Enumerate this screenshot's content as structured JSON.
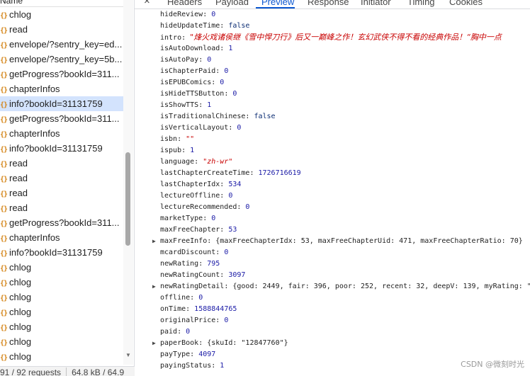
{
  "request_list": {
    "header": "Name",
    "items": [
      {
        "label": "chlog",
        "selected": false
      },
      {
        "label": "read",
        "selected": false
      },
      {
        "label": "envelope/?sentry_key=ed...",
        "selected": false
      },
      {
        "label": "envelope/?sentry_key=5b...",
        "selected": false
      },
      {
        "label": "getProgress?bookId=311...",
        "selected": false
      },
      {
        "label": "chapterInfos",
        "selected": false
      },
      {
        "label": "info?bookId=31131759",
        "selected": true
      },
      {
        "label": "getProgress?bookId=311...",
        "selected": false
      },
      {
        "label": "chapterInfos",
        "selected": false
      },
      {
        "label": "info?bookId=31131759",
        "selected": false
      },
      {
        "label": "read",
        "selected": false
      },
      {
        "label": "read",
        "selected": false
      },
      {
        "label": "read",
        "selected": false
      },
      {
        "label": "read",
        "selected": false
      },
      {
        "label": "getProgress?bookId=311...",
        "selected": false
      },
      {
        "label": "chapterInfos",
        "selected": false
      },
      {
        "label": "info?bookId=31131759",
        "selected": false
      },
      {
        "label": "chlog",
        "selected": false
      },
      {
        "label": "chlog",
        "selected": false
      },
      {
        "label": "chlog",
        "selected": false
      },
      {
        "label": "chlog",
        "selected": false
      },
      {
        "label": "chlog",
        "selected": false
      },
      {
        "label": "chlog",
        "selected": false
      },
      {
        "label": "chlog",
        "selected": false
      }
    ],
    "item_icon_text": "{}",
    "status": {
      "requests": "91 / 92 requests",
      "transferred": "64.8 kB / 64.9"
    }
  },
  "detail_tabs": {
    "close_glyph": "×",
    "tabs": [
      "Headers",
      "Payload",
      "Preview",
      "Response",
      "Initiator",
      "Timing",
      "Cookies"
    ],
    "active": "Preview"
  },
  "preview": {
    "properties": [
      {
        "key": "hideReview",
        "value": "0",
        "type": "num"
      },
      {
        "key": "hideUpdateTime",
        "value": "false",
        "type": "kw"
      },
      {
        "key": "intro",
        "value": "\"烽火戏诸侯继《雪中悍刀行》后又一巅峰之作！玄幻武侠不得不看的经典作品！“胸中一点",
        "type": "str"
      },
      {
        "key": "isAutoDownload",
        "value": "1",
        "type": "num"
      },
      {
        "key": "isAutoPay",
        "value": "0",
        "type": "num"
      },
      {
        "key": "isChapterPaid",
        "value": "0",
        "type": "num"
      },
      {
        "key": "isEPUBComics",
        "value": "0",
        "type": "num"
      },
      {
        "key": "isHideTTSButton",
        "value": "0",
        "type": "num"
      },
      {
        "key": "isShowTTS",
        "value": "1",
        "type": "num"
      },
      {
        "key": "isTraditionalChinese",
        "value": "false",
        "type": "kw"
      },
      {
        "key": "isVerticalLayout",
        "value": "0",
        "type": "num"
      },
      {
        "key": "isbn",
        "value": "\"\"",
        "type": "str"
      },
      {
        "key": "ispub",
        "value": "1",
        "type": "num"
      },
      {
        "key": "language",
        "value": "\"zh-wr\"",
        "type": "str"
      },
      {
        "key": "lastChapterCreateTime",
        "value": "1726716619",
        "type": "num"
      },
      {
        "key": "lastChapterIdx",
        "value": "534",
        "type": "num"
      },
      {
        "key": "lectureOffline",
        "value": "0",
        "type": "num"
      },
      {
        "key": "lectureRecommended",
        "value": "0",
        "type": "num"
      },
      {
        "key": "marketType",
        "value": "0",
        "type": "num"
      },
      {
        "key": "maxFreeChapter",
        "value": "53",
        "type": "num"
      },
      {
        "key": "maxFreeInfo",
        "value": "{maxFreeChapterIdx: 53, maxFreeChapterUid: 471, maxFreeChapterRatio: 70}",
        "type": "obj",
        "expandable": true
      },
      {
        "key": "mcardDiscount",
        "value": "0",
        "type": "num"
      },
      {
        "key": "newRating",
        "value": "795",
        "type": "num"
      },
      {
        "key": "newRatingCount",
        "value": "3097",
        "type": "num"
      },
      {
        "key": "newRatingDetail",
        "value": "{good: 2449, fair: 396, poor: 252, recent: 32, deepV: 139, myRating: \"",
        "type": "obj",
        "expandable": true
      },
      {
        "key": "offline",
        "value": "0",
        "type": "num"
      },
      {
        "key": "onTime",
        "value": "1588844765",
        "type": "num"
      },
      {
        "key": "originalPrice",
        "value": "0",
        "type": "num"
      },
      {
        "key": "paid",
        "value": "0",
        "type": "num"
      },
      {
        "key": "paperBook",
        "value": "{skuId: \"12847760\"}",
        "type": "obj",
        "expandable": true
      },
      {
        "key": "payType",
        "value": "4097",
        "type": "num"
      },
      {
        "key": "payingStatus",
        "value": "1",
        "type": "num"
      }
    ],
    "expand_glyph": "▶"
  },
  "watermark": "CSDN @微刻时光",
  "colors": {
    "accent": "#0b57d0",
    "selected_row": "#d3e3fd",
    "number": "#1a1aa6",
    "string": "#c80000"
  }
}
